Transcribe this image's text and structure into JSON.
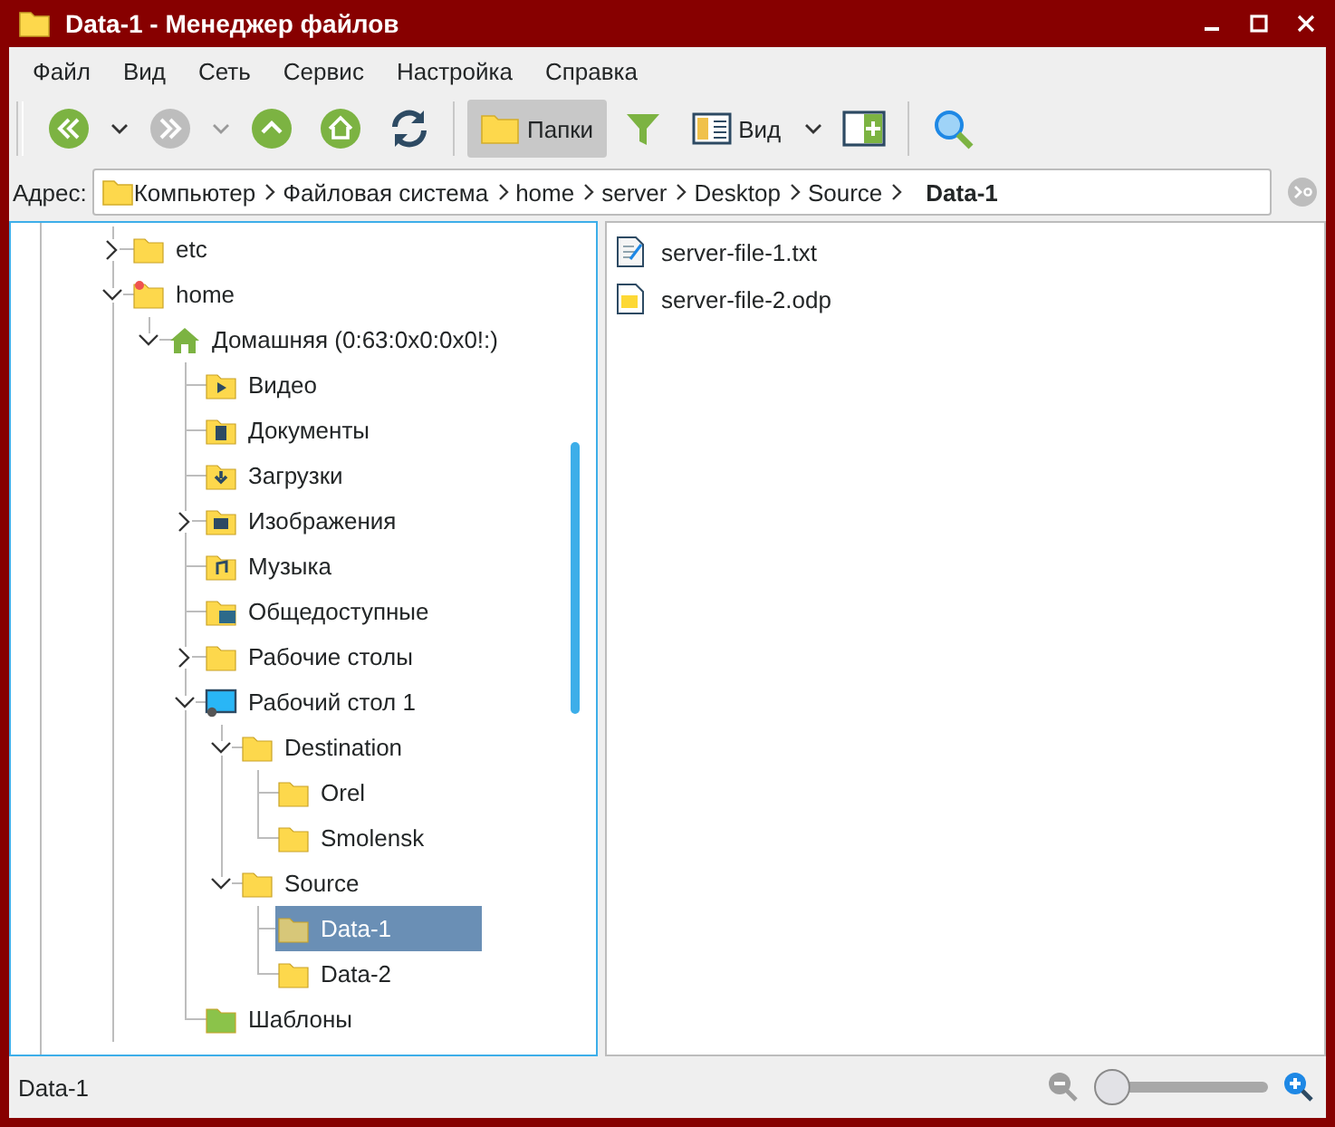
{
  "window": {
    "title": "Data-1 - Менеджер файлов"
  },
  "menu": [
    "Файл",
    "Вид",
    "Сеть",
    "Сервис",
    "Настройка",
    "Справка"
  ],
  "toolbar": {
    "back": {
      "disabled": false
    },
    "forward": {
      "disabled": true
    },
    "folders_button": {
      "label": "Папки",
      "selected": true
    },
    "view_button": {
      "label": "Вид"
    }
  },
  "address": {
    "label": "Адрес:",
    "path": [
      {
        "label": "Компьютер",
        "current": false
      },
      {
        "label": "Файловая система",
        "current": false
      },
      {
        "label": "home",
        "current": false
      },
      {
        "label": "server",
        "current": false
      },
      {
        "label": "Desktop",
        "current": false
      },
      {
        "label": "Source",
        "current": false
      },
      {
        "label": "Data-1",
        "current": true
      }
    ]
  },
  "tree": [
    {
      "label": "etc",
      "kind": "folder",
      "expanded": false,
      "selected": false
    },
    {
      "label": "home",
      "kind": "folder-marked",
      "expanded": true,
      "selected": false,
      "children": [
        {
          "label": "Домашняя (0:63:0x0:0x0!:)",
          "kind": "home",
          "expanded": true,
          "selected": false,
          "children": [
            {
              "label": "Видео",
              "kind": "video",
              "selected": false
            },
            {
              "label": "Документы",
              "kind": "documents",
              "selected": false
            },
            {
              "label": "Загрузки",
              "kind": "downloads",
              "selected": false
            },
            {
              "label": "Изображения",
              "kind": "pictures",
              "expanded": false,
              "selected": false
            },
            {
              "label": "Музыка",
              "kind": "music",
              "selected": false
            },
            {
              "label": "Общедоступные",
              "kind": "public",
              "selected": false
            },
            {
              "label": "Рабочие столы",
              "kind": "folder",
              "expanded": false,
              "selected": false
            },
            {
              "label": "Рабочий стол 1",
              "kind": "desktop",
              "expanded": true,
              "selected": false,
              "children": [
                {
                  "label": "Destination",
                  "kind": "folder",
                  "expanded": true,
                  "selected": false,
                  "children": [
                    {
                      "label": "Orel",
                      "kind": "folder",
                      "selected": false
                    },
                    {
                      "label": "Smolensk",
                      "kind": "folder",
                      "selected": false
                    }
                  ]
                },
                {
                  "label": "Source",
                  "kind": "folder",
                  "expanded": true,
                  "selected": false,
                  "children": [
                    {
                      "label": "Data-1",
                      "kind": "folder",
                      "selected": true
                    },
                    {
                      "label": "Data-2",
                      "kind": "folder",
                      "selected": false
                    }
                  ]
                }
              ]
            },
            {
              "label": "Шаблоны",
              "kind": "templates",
              "selected": false
            }
          ]
        }
      ]
    }
  ],
  "files": [
    {
      "name": "server-file-1.txt",
      "kind": "text"
    },
    {
      "name": "server-file-2.odp",
      "kind": "presentation"
    }
  ],
  "status_bar": {
    "text": "Data-1",
    "zoom": {
      "level": 0.0
    }
  }
}
